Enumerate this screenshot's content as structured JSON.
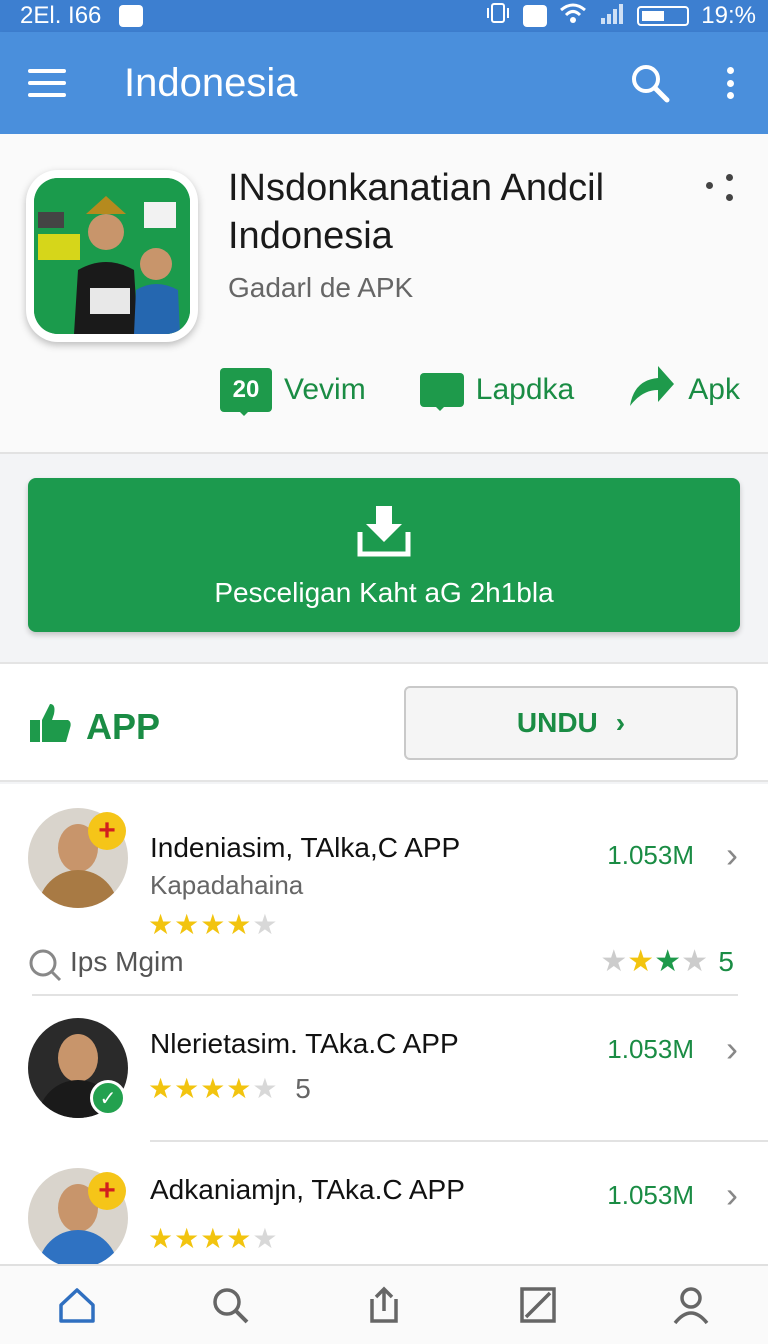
{
  "status_bar": {
    "time_left": "2El. I66",
    "time_right": "19:%"
  },
  "app_bar": {
    "title": "Indonesia",
    "menu_icon": "hamburger-menu-icon",
    "search_icon": "search-icon",
    "more_icon": "more-vert-icon"
  },
  "app_header": {
    "title": "INsdonkanatian Andcil Indonesia",
    "subtitle": "Gadarl de APK",
    "actions": [
      {
        "badge": "20",
        "label": "Vevim",
        "icon": "comment-count-icon"
      },
      {
        "label": "Lapdka",
        "icon": "chat-bubble-icon"
      },
      {
        "label": "Apk",
        "icon": "share-arrow-icon"
      }
    ]
  },
  "download_button": {
    "label": "Pesceligan Kaht aG 2h1bla",
    "icon": "download-icon"
  },
  "section": {
    "tag_label": "APP",
    "tag_icon": "thumbs-up-icon",
    "button_label": "UNDU",
    "button_chevron": "›"
  },
  "list": {
    "items": [
      {
        "title": "Indeniasim, TAlka,C APP",
        "subtitle": "Kapadahaina",
        "rating": 4.5,
        "stars": "★★★★",
        "half": "★",
        "count": "1.053M"
      },
      {
        "title": "Nlerietasim. TAka.C APP",
        "rating": 4.5,
        "stars": "★★★★",
        "half": "★",
        "rating_number": "5",
        "count": "1.053M"
      },
      {
        "title": "Adkaniamjn, TAka.C APP",
        "rating": 4.5,
        "stars": "★★★★",
        "half": "★",
        "count": "1.053M"
      }
    ],
    "search_row": {
      "label": "Ips Mgim",
      "number": "5"
    }
  },
  "colors": {
    "appbar": "#4a8fdc",
    "statusbar": "#3d7fd0",
    "accent_green": "#1c9a4e",
    "star": "#f2c40f"
  },
  "bottom_nav": [
    "home-icon",
    "search-icon",
    "share-icon",
    "edit-icon",
    "profile-icon"
  ]
}
